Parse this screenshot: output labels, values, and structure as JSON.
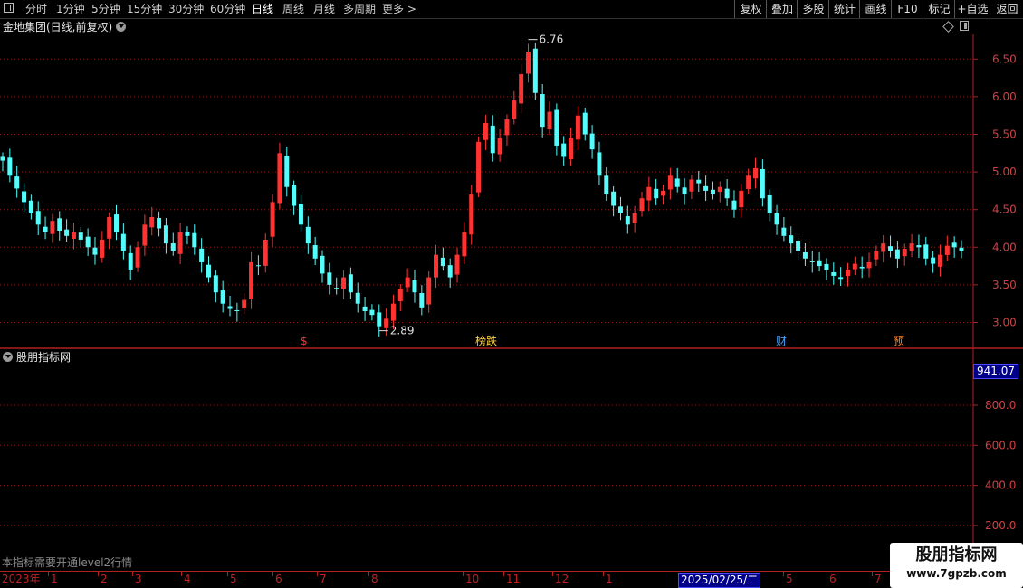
{
  "toolbar": {
    "periods": [
      {
        "label": "分时",
        "active": false
      },
      {
        "label": "1分钟",
        "active": false
      },
      {
        "label": "5分钟",
        "active": false
      },
      {
        "label": "15分钟",
        "active": false
      },
      {
        "label": "30分钟",
        "active": false
      },
      {
        "label": "60分钟",
        "active": false
      },
      {
        "label": "日线",
        "active": true
      },
      {
        "label": "周线",
        "active": false
      },
      {
        "label": "月线",
        "active": false
      },
      {
        "label": "多周期",
        "active": false
      },
      {
        "label": "更多 >",
        "active": false
      }
    ],
    "right_buttons": [
      "复权",
      "叠加",
      "多股",
      "统计",
      "画线",
      "F10",
      "标记",
      "+自选",
      "返回"
    ]
  },
  "main_chart": {
    "title": "金地集团(日线,前复权)",
    "price_ticks": [
      "6.50",
      "6.00",
      "5.50",
      "5.00",
      "4.50",
      "4.00",
      "3.50",
      "3.00"
    ],
    "high_label": "6.76",
    "low_label": "2.89",
    "markers": [
      {
        "label": "$",
        "color": "#ff3030"
      },
      {
        "label": "榜跌",
        "color": "#ffd040"
      },
      {
        "label": "财",
        "color": "#40a0ff"
      },
      {
        "label": "预",
        "color": "#ff8020"
      }
    ]
  },
  "sub_chart": {
    "title": "股朋指标网",
    "value_ticks": [
      "800.0",
      "600.0",
      "400.0",
      "200.0"
    ],
    "cursor_value": "941.07",
    "note": "本指标需要开通level2行情"
  },
  "date_axis": {
    "year_label": "2023年",
    "month_labels": [
      "1",
      "2",
      "3",
      "4",
      "5",
      "6",
      "7",
      "8",
      "10",
      "11",
      "12",
      "1",
      "5",
      "6",
      "7"
    ],
    "cursor_date": "2025/02/25/二"
  },
  "watermark": {
    "title": "股朋指标网",
    "url": "www.7gpzb.com"
  },
  "colors": {
    "up": "#ff3232",
    "down": "#54fcfc",
    "grid": "#8b1a1a",
    "axis": "#b02020",
    "cursor_bg": "#000088"
  },
  "chart_data": {
    "type": "candlestick",
    "title": "金地集团(日线,前复权)",
    "ylim": [
      2.8,
      6.8
    ],
    "y_ticks": [
      3.0,
      3.5,
      4.0,
      4.5,
      5.0,
      5.5,
      6.0,
      6.5
    ],
    "x_tick_labels": [
      "2023年",
      "1",
      "2",
      "3",
      "4",
      "5",
      "6",
      "7",
      "8",
      "10",
      "11",
      "12",
      "1",
      "2025/02/25/二",
      "5",
      "6",
      "7"
    ],
    "close": [
      5.15,
      4.95,
      4.78,
      4.6,
      4.45,
      4.3,
      4.2,
      4.35,
      4.22,
      4.15,
      4.2,
      4.1,
      4.0,
      3.9,
      4.1,
      4.4,
      4.2,
      3.95,
      3.7,
      4.0,
      4.3,
      4.4,
      4.25,
      4.05,
      3.95,
      4.2,
      4.15,
      4.0,
      3.8,
      3.6,
      3.4,
      3.25,
      3.18,
      3.15,
      3.3,
      3.8,
      3.75,
      4.1,
      4.6,
      5.25,
      4.8,
      4.55,
      4.3,
      4.05,
      3.85,
      3.65,
      3.5,
      3.45,
      3.6,
      3.4,
      3.25,
      3.15,
      3.1,
      2.95,
      3.05,
      3.25,
      3.45,
      3.6,
      3.4,
      3.2,
      3.6,
      3.9,
      3.75,
      3.6,
      3.9,
      4.2,
      4.7,
      5.4,
      5.65,
      5.25,
      5.45,
      5.7,
      5.95,
      6.3,
      6.6,
      6.05,
      5.6,
      5.8,
      5.35,
      5.2,
      5.45,
      5.75,
      5.5,
      5.3,
      4.95,
      4.7,
      4.55,
      4.45,
      4.3,
      4.45,
      4.65,
      4.8,
      4.65,
      4.75,
      4.95,
      4.8,
      4.7,
      4.9,
      4.85,
      4.75,
      4.7,
      4.8,
      4.65,
      4.5,
      4.75,
      4.95,
      5.05,
      4.65,
      4.45,
      4.3,
      4.15,
      4.05,
      3.95,
      3.85,
      3.8,
      3.75,
      3.7,
      3.62,
      3.58,
      3.7,
      3.78,
      3.72,
      3.8,
      3.95,
      4.05,
      3.95,
      3.85,
      3.98,
      4.05,
      4.0,
      3.85,
      3.78,
      3.9,
      4.02,
      4.0,
      3.95
    ],
    "high_marker": 6.76,
    "low_marker": 2.89
  }
}
